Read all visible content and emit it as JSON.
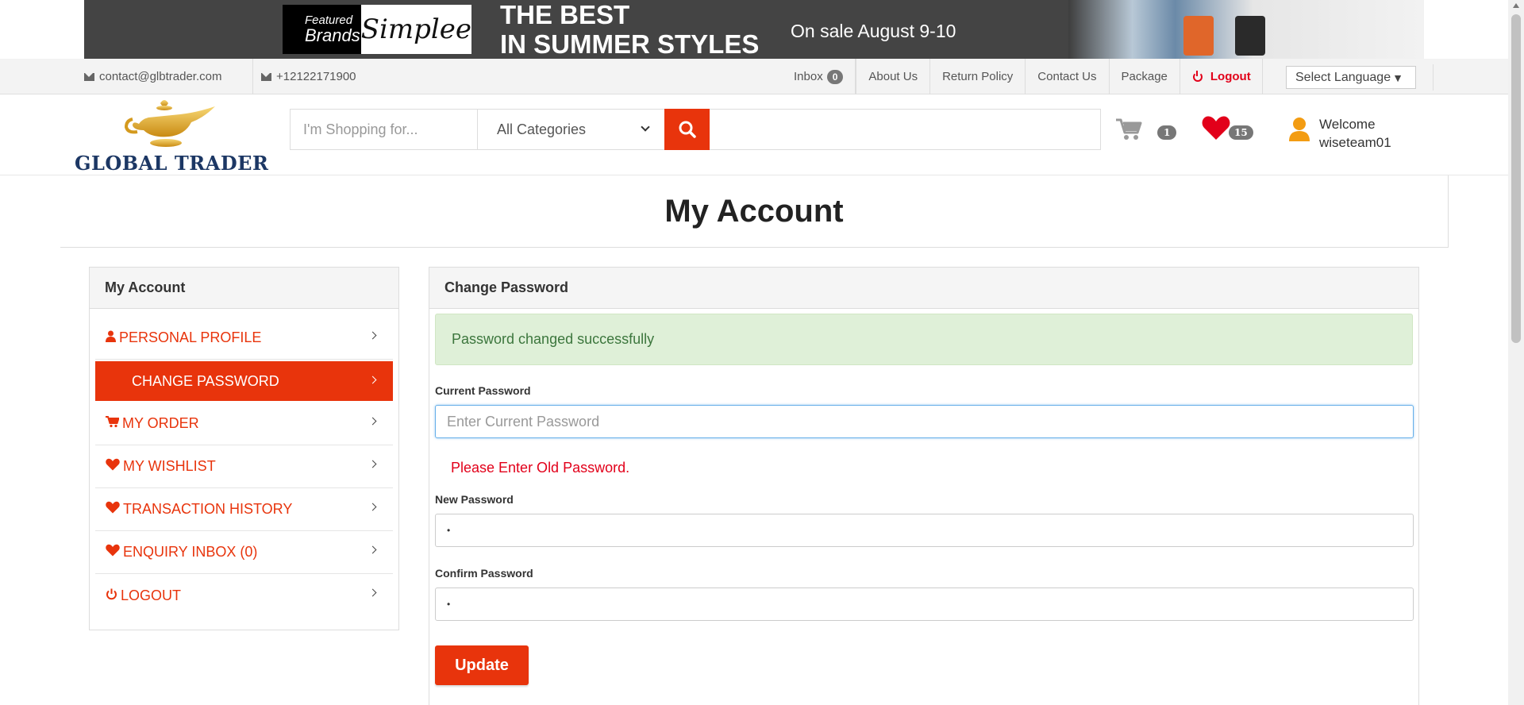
{
  "banner": {
    "featured_line1": "Featured",
    "featured_line2": "Brands",
    "brand_name": "Simplee",
    "headline_line1": "THE BEST",
    "headline_line2": "IN SUMMER STYLES",
    "sale_text": "On sale August 9-10"
  },
  "topbar": {
    "email": "contact@glbtrader.com",
    "phone": "+12122171900",
    "nav": {
      "inbox": "Inbox",
      "inbox_count": "0",
      "about": "About Us",
      "return_policy": "Return Policy",
      "contact": "Contact Us",
      "package": "Package",
      "logout": "Logout"
    },
    "language": "Select Language",
    "language_arrow": "▼"
  },
  "header": {
    "logo_text": "GLOBAL TRADER",
    "search_placeholder": "I'm Shopping for...",
    "category": "All Categories",
    "cart_count": "1",
    "wishlist_count": "15",
    "welcome_line1": "Welcome",
    "welcome_line2": "wiseteam01"
  },
  "page_title": "My Account",
  "sidebar": {
    "title": "My Account",
    "items": [
      {
        "label": "PERSONAL PROFILE",
        "icon": "user-icon"
      },
      {
        "label": "CHANGE PASSWORD",
        "icon": "none"
      },
      {
        "label": "MY ORDER",
        "icon": "cart-icon"
      },
      {
        "label": "MY WISHLIST",
        "icon": "heart-icon"
      },
      {
        "label": "TRANSACTION HISTORY",
        "icon": "heart-icon"
      },
      {
        "label": "ENQUIRY INBOX (0)",
        "icon": "heart-icon"
      },
      {
        "label": "LOGOUT",
        "icon": "power-icon"
      }
    ]
  },
  "panel": {
    "title": "Change Password",
    "alert": "Password changed successfully",
    "current_label": "Current Password",
    "current_placeholder": "Enter Current Password",
    "current_value": "",
    "error": "Please Enter Old Password.",
    "new_label": "New Password",
    "new_value": "•",
    "confirm_label": "Confirm Password",
    "confirm_value": "•",
    "update_label": "Update"
  },
  "colors": {
    "accent": "#e8340c",
    "success_bg": "#dff0d8",
    "success_text": "#3c763d",
    "error_text": "#e2001a",
    "logo_blue": "#1c3764",
    "user_orange": "#f39c12"
  }
}
